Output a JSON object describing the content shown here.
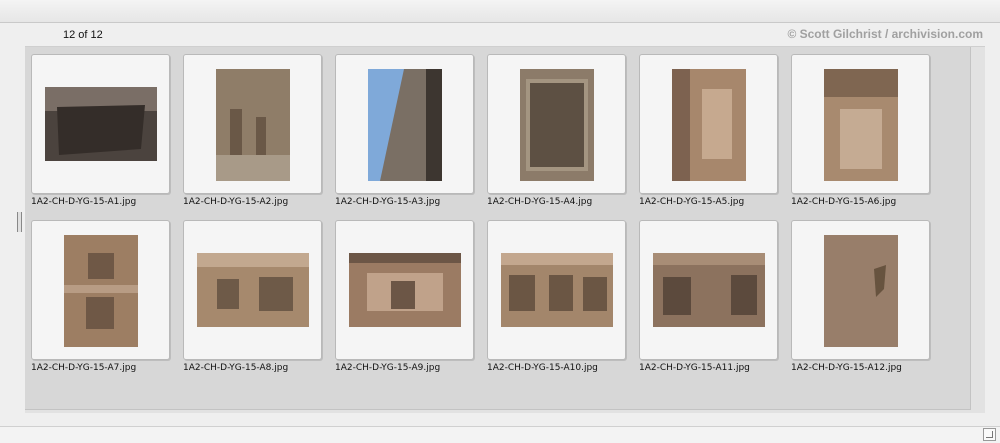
{
  "counter": "12 of 12",
  "credit": "© Scott Gilchrist / archivision.com",
  "thumbnails": [
    {
      "filename": "1A2-CH-D-YG-15-A1.jpg",
      "colors": [
        "#4b433e",
        "#7a6e66",
        "#342d29"
      ]
    },
    {
      "filename": "1A2-CH-D-YG-15-A2.jpg",
      "colors": [
        "#8f7d68",
        "#6a5847",
        "#a89a88"
      ]
    },
    {
      "filename": "1A2-CH-D-YG-15-A3.jpg",
      "colors": [
        "#7a6f64",
        "#3d3630",
        "#7fa9d9"
      ]
    },
    {
      "filename": "1A2-CH-D-YG-15-A4.jpg",
      "colors": [
        "#8c7b69",
        "#5d5043",
        "#a49581"
      ]
    },
    {
      "filename": "1A2-CH-D-YG-15-A5.jpg",
      "colors": [
        "#a7876c",
        "#7d6250",
        "#c6a98f"
      ]
    },
    {
      "filename": "1A2-CH-D-YG-15-A6.jpg",
      "colors": [
        "#a88a6f",
        "#7f6651",
        "#c5ab93"
      ]
    },
    {
      "filename": "1A2-CH-D-YG-15-A7.jpg",
      "colors": [
        "#9d7e63",
        "#6f5846",
        "#b89c84"
      ]
    },
    {
      "filename": "1A2-CH-D-YG-15-A8.jpg",
      "colors": [
        "#a6896d",
        "#6e5a48",
        "#c2a88f"
      ]
    },
    {
      "filename": "1A2-CH-D-YG-15-A9.jpg",
      "colors": [
        "#9b7b63",
        "#6c5646",
        "#c0a28a"
      ]
    },
    {
      "filename": "1A2-CH-D-YG-15-A10.jpg",
      "colors": [
        "#a3866b",
        "#6b5644",
        "#c3a78e"
      ]
    },
    {
      "filename": "1A2-CH-D-YG-15-A11.jpg",
      "colors": [
        "#8c725e",
        "#5c4a3d",
        "#a88d76"
      ]
    },
    {
      "filename": "1A2-CH-D-YG-15-A12.jpg",
      "colors": [
        "#8f7662",
        "#67533f",
        "#a88f7a"
      ]
    }
  ]
}
